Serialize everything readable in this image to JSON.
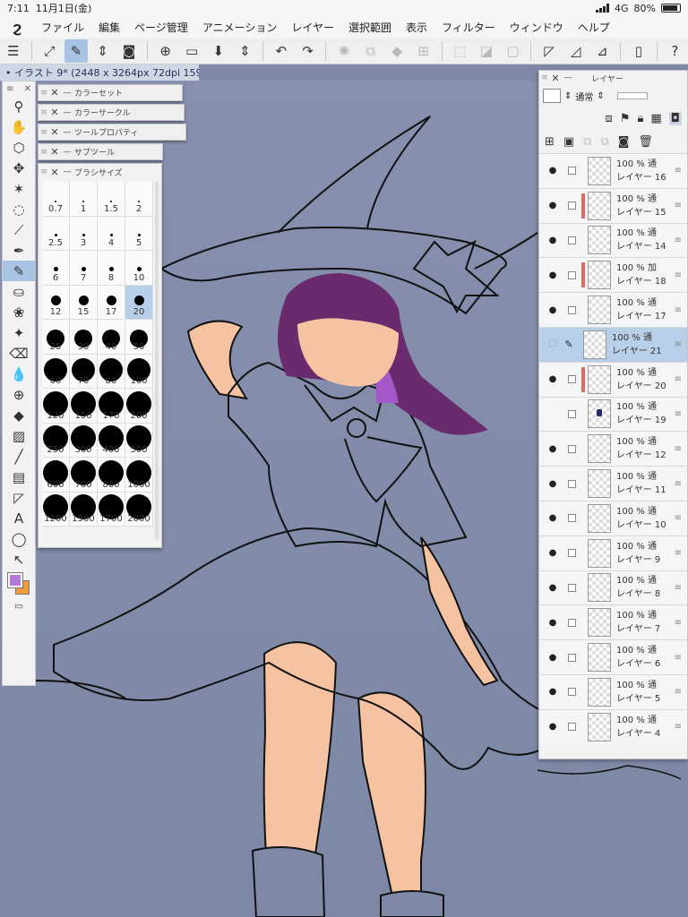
{
  "status": {
    "time": "7:11",
    "date": "11月1日(金)",
    "network": "4G",
    "battery": "80%"
  },
  "menu": {
    "items": [
      "ファイル",
      "編集",
      "ページ管理",
      "アニメーション",
      "レイヤー",
      "選択範囲",
      "表示",
      "フィルター",
      "ウィンドウ",
      "ヘルプ"
    ]
  },
  "document": {
    "tab_label": "• イラスト 9* (2448 x 3264px 72dpi 159.3%)"
  },
  "panels": {
    "color_set": "カラーセット",
    "color_circle": "カラーサークル",
    "tool_property": "ツールプロパティ",
    "sub_tool": "サブツール",
    "brush_size": "ブラシサイズ",
    "layer": "レイヤー"
  },
  "brush_sizes": [
    "0.7",
    "1",
    "1.5",
    "2",
    "2.5",
    "3",
    "4",
    "5",
    "6",
    "7",
    "8",
    "10",
    "12",
    "15",
    "17",
    "20",
    "25",
    "30",
    "40",
    "50",
    "60",
    "70",
    "80",
    "100",
    "120",
    "150",
    "170",
    "200",
    "250",
    "300",
    "400",
    "500",
    "600",
    "700",
    "800",
    "1000",
    "1200",
    "1500",
    "1700",
    "2000"
  ],
  "brush_selected": "20",
  "layer_panel": {
    "blend_mode": "通常",
    "layers": [
      {
        "opacity": "100 %",
        "mode": "通",
        "name": "レイヤー 16",
        "visible": true,
        "flag": false,
        "selected": false
      },
      {
        "opacity": "100 %",
        "mode": "通",
        "name": "レイヤー 15",
        "visible": true,
        "flag": true,
        "selected": false
      },
      {
        "opacity": "100 %",
        "mode": "通",
        "name": "レイヤー 14",
        "visible": true,
        "flag": false,
        "selected": false
      },
      {
        "opacity": "100 %",
        "mode": "加",
        "name": "レイヤー 18",
        "visible": true,
        "flag": true,
        "selected": false
      },
      {
        "opacity": "100 %",
        "mode": "通",
        "name": "レイヤー 17",
        "visible": true,
        "flag": false,
        "selected": false
      },
      {
        "opacity": "100 %",
        "mode": "通",
        "name": "レイヤー 21",
        "visible": false,
        "flag": false,
        "selected": true
      },
      {
        "opacity": "100 %",
        "mode": "通",
        "name": "レイヤー 20",
        "visible": true,
        "flag": true,
        "selected": false
      },
      {
        "opacity": "100 %",
        "mode": "通",
        "name": "レイヤー 19",
        "visible": false,
        "flag": false,
        "selected": false
      },
      {
        "opacity": "100 %",
        "mode": "通",
        "name": "レイヤー 12",
        "visible": true,
        "flag": false,
        "selected": false
      },
      {
        "opacity": "100 %",
        "mode": "通",
        "name": "レイヤー 11",
        "visible": true,
        "flag": false,
        "selected": false
      },
      {
        "opacity": "100 %",
        "mode": "通",
        "name": "レイヤー 10",
        "visible": true,
        "flag": false,
        "selected": false
      },
      {
        "opacity": "100 %",
        "mode": "通",
        "name": "レイヤー 9",
        "visible": true,
        "flag": false,
        "selected": false
      },
      {
        "opacity": "100 %",
        "mode": "通",
        "name": "レイヤー 8",
        "visible": true,
        "flag": false,
        "selected": false
      },
      {
        "opacity": "100 %",
        "mode": "通",
        "name": "レイヤー 7",
        "visible": true,
        "flag": false,
        "selected": false
      },
      {
        "opacity": "100 %",
        "mode": "通",
        "name": "レイヤー 6",
        "visible": true,
        "flag": false,
        "selected": false
      },
      {
        "opacity": "100 %",
        "mode": "通",
        "name": "レイヤー 5",
        "visible": true,
        "flag": false,
        "selected": false
      },
      {
        "opacity": "100 %",
        "mode": "通",
        "name": "レイヤー 4",
        "visible": true,
        "flag": false,
        "selected": false
      }
    ]
  },
  "colors": {
    "main_color": "#b07ad6",
    "sub_color": "#ef9a3c",
    "canvas_bg": "#8790ae",
    "selection": "#b8cfea"
  },
  "icons": {
    "toolbar": [
      "menu-icon",
      "fullscreen-icon",
      "edit-mode-icon",
      "chevron-updown-icon",
      "snapshot-icon",
      "new-page-icon",
      "open-folder-icon",
      "save-icon",
      "chevron-updown-icon",
      "undo-icon",
      "redo-icon",
      "loading-icon",
      "copy-icon",
      "fill-icon",
      "transform-icon",
      "clear-selection-icon",
      "invert-selection-icon",
      "selection-border-icon",
      "ruler-icon",
      "brush-ruler-icon",
      "perspective-icon",
      "device-icon",
      "help-icon"
    ],
    "tools": [
      "zoom-icon",
      "hand-icon",
      "object-icon",
      "move-icon",
      "magic-wand-icon",
      "lasso-icon",
      "eyedropper-icon",
      "pen-icon",
      "pencil-icon",
      "stamp-icon",
      "decoration-icon",
      "sparkle-icon",
      "eraser-icon",
      "blend-icon",
      "mesh-icon",
      "fill-bucket-icon",
      "gradient-icon",
      "line-icon",
      "frame-icon",
      "ruler-tool-icon",
      "text-icon",
      "balloon-icon",
      "correction-icon"
    ]
  }
}
